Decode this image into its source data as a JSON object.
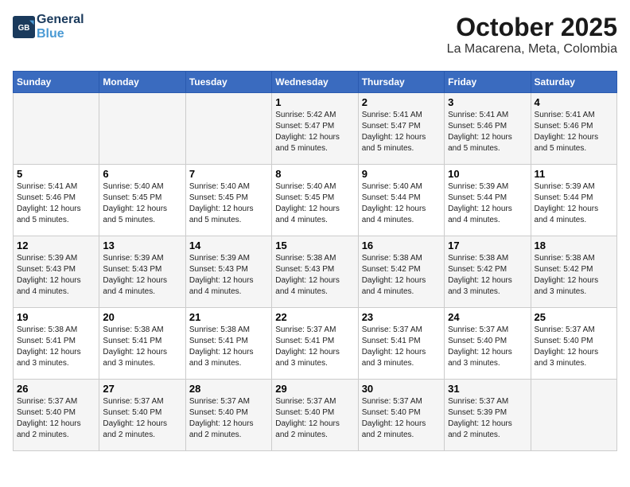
{
  "brand": {
    "line1": "General",
    "line2": "Blue"
  },
  "title": "October 2025",
  "location": "La Macarena, Meta, Colombia",
  "days_of_week": [
    "Sunday",
    "Monday",
    "Tuesday",
    "Wednesday",
    "Thursday",
    "Friday",
    "Saturday"
  ],
  "weeks": [
    [
      {
        "day": "",
        "info": ""
      },
      {
        "day": "",
        "info": ""
      },
      {
        "day": "",
        "info": ""
      },
      {
        "day": "1",
        "info": "Sunrise: 5:42 AM\nSunset: 5:47 PM\nDaylight: 12 hours\nand 5 minutes."
      },
      {
        "day": "2",
        "info": "Sunrise: 5:41 AM\nSunset: 5:47 PM\nDaylight: 12 hours\nand 5 minutes."
      },
      {
        "day": "3",
        "info": "Sunrise: 5:41 AM\nSunset: 5:46 PM\nDaylight: 12 hours\nand 5 minutes."
      },
      {
        "day": "4",
        "info": "Sunrise: 5:41 AM\nSunset: 5:46 PM\nDaylight: 12 hours\nand 5 minutes."
      }
    ],
    [
      {
        "day": "5",
        "info": "Sunrise: 5:41 AM\nSunset: 5:46 PM\nDaylight: 12 hours\nand 5 minutes."
      },
      {
        "day": "6",
        "info": "Sunrise: 5:40 AM\nSunset: 5:45 PM\nDaylight: 12 hours\nand 5 minutes."
      },
      {
        "day": "7",
        "info": "Sunrise: 5:40 AM\nSunset: 5:45 PM\nDaylight: 12 hours\nand 5 minutes."
      },
      {
        "day": "8",
        "info": "Sunrise: 5:40 AM\nSunset: 5:45 PM\nDaylight: 12 hours\nand 4 minutes."
      },
      {
        "day": "9",
        "info": "Sunrise: 5:40 AM\nSunset: 5:44 PM\nDaylight: 12 hours\nand 4 minutes."
      },
      {
        "day": "10",
        "info": "Sunrise: 5:39 AM\nSunset: 5:44 PM\nDaylight: 12 hours\nand 4 minutes."
      },
      {
        "day": "11",
        "info": "Sunrise: 5:39 AM\nSunset: 5:44 PM\nDaylight: 12 hours\nand 4 minutes."
      }
    ],
    [
      {
        "day": "12",
        "info": "Sunrise: 5:39 AM\nSunset: 5:43 PM\nDaylight: 12 hours\nand 4 minutes."
      },
      {
        "day": "13",
        "info": "Sunrise: 5:39 AM\nSunset: 5:43 PM\nDaylight: 12 hours\nand 4 minutes."
      },
      {
        "day": "14",
        "info": "Sunrise: 5:39 AM\nSunset: 5:43 PM\nDaylight: 12 hours\nand 4 minutes."
      },
      {
        "day": "15",
        "info": "Sunrise: 5:38 AM\nSunset: 5:43 PM\nDaylight: 12 hours\nand 4 minutes."
      },
      {
        "day": "16",
        "info": "Sunrise: 5:38 AM\nSunset: 5:42 PM\nDaylight: 12 hours\nand 4 minutes."
      },
      {
        "day": "17",
        "info": "Sunrise: 5:38 AM\nSunset: 5:42 PM\nDaylight: 12 hours\nand 3 minutes."
      },
      {
        "day": "18",
        "info": "Sunrise: 5:38 AM\nSunset: 5:42 PM\nDaylight: 12 hours\nand 3 minutes."
      }
    ],
    [
      {
        "day": "19",
        "info": "Sunrise: 5:38 AM\nSunset: 5:41 PM\nDaylight: 12 hours\nand 3 minutes."
      },
      {
        "day": "20",
        "info": "Sunrise: 5:38 AM\nSunset: 5:41 PM\nDaylight: 12 hours\nand 3 minutes."
      },
      {
        "day": "21",
        "info": "Sunrise: 5:38 AM\nSunset: 5:41 PM\nDaylight: 12 hours\nand 3 minutes."
      },
      {
        "day": "22",
        "info": "Sunrise: 5:37 AM\nSunset: 5:41 PM\nDaylight: 12 hours\nand 3 minutes."
      },
      {
        "day": "23",
        "info": "Sunrise: 5:37 AM\nSunset: 5:41 PM\nDaylight: 12 hours\nand 3 minutes."
      },
      {
        "day": "24",
        "info": "Sunrise: 5:37 AM\nSunset: 5:40 PM\nDaylight: 12 hours\nand 3 minutes."
      },
      {
        "day": "25",
        "info": "Sunrise: 5:37 AM\nSunset: 5:40 PM\nDaylight: 12 hours\nand 3 minutes."
      }
    ],
    [
      {
        "day": "26",
        "info": "Sunrise: 5:37 AM\nSunset: 5:40 PM\nDaylight: 12 hours\nand 2 minutes."
      },
      {
        "day": "27",
        "info": "Sunrise: 5:37 AM\nSunset: 5:40 PM\nDaylight: 12 hours\nand 2 minutes."
      },
      {
        "day": "28",
        "info": "Sunrise: 5:37 AM\nSunset: 5:40 PM\nDaylight: 12 hours\nand 2 minutes."
      },
      {
        "day": "29",
        "info": "Sunrise: 5:37 AM\nSunset: 5:40 PM\nDaylight: 12 hours\nand 2 minutes."
      },
      {
        "day": "30",
        "info": "Sunrise: 5:37 AM\nSunset: 5:40 PM\nDaylight: 12 hours\nand 2 minutes."
      },
      {
        "day": "31",
        "info": "Sunrise: 5:37 AM\nSunset: 5:39 PM\nDaylight: 12 hours\nand 2 minutes."
      },
      {
        "day": "",
        "info": ""
      }
    ]
  ]
}
